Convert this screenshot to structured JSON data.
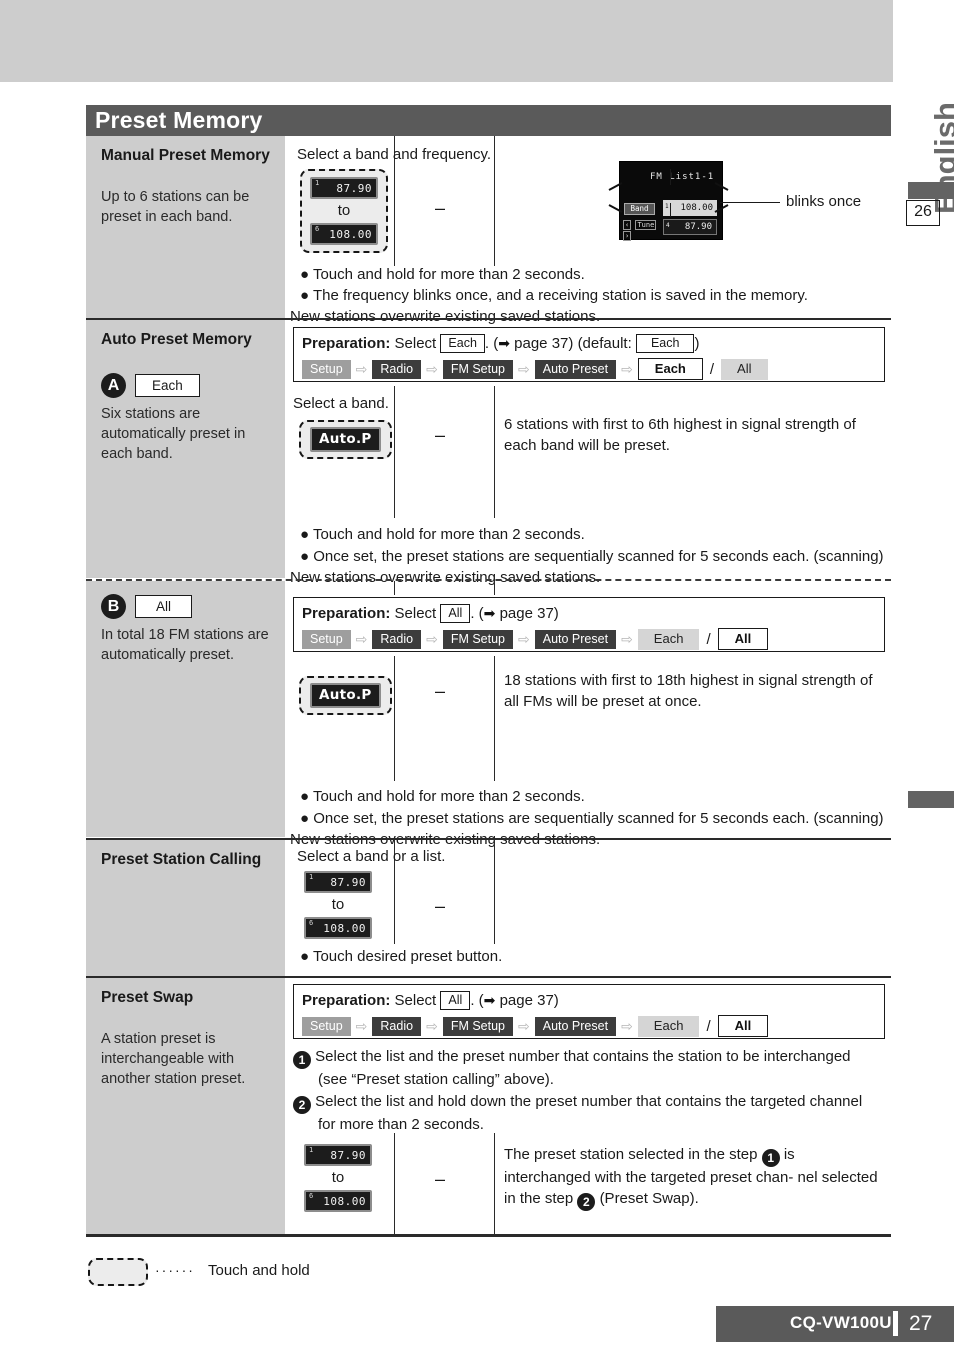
{
  "page": {
    "language_tab": "English",
    "side_page_ref": "26",
    "title": "Preset Memory",
    "model": "CQ-VW100U",
    "page_number": "27"
  },
  "legend": {
    "dots": "······",
    "text": "Touch and hold"
  },
  "lcd": {
    "title": "FM List1-1",
    "band_label": "Band",
    "tune_label": "Tune",
    "tune_left": "‹",
    "tune_right": "›",
    "highlight_num": "1",
    "highlight_value": "108.00",
    "lower_num": "4",
    "lower_value": "87.90",
    "callout": "blinks once"
  },
  "freq_keys": {
    "first_num": "1",
    "first_value": "87.90",
    "last_num": "6",
    "last_value": "108.00",
    "to": "to",
    "dash": "–"
  },
  "auto_p_label": "Auto.P",
  "sections": [
    {
      "id": "manual-preset-memory",
      "heading": "Manual Preset Memory",
      "desc": "Up to 6 stations can be preset in each band.",
      "instruction": "Select a band and frequency.",
      "notes": [
        "● Touch and hold for more than 2 seconds.",
        "● The frequency blinks once, and a receiving station is saved in the memory.",
        "New stations overwrite existing saved stations."
      ]
    },
    {
      "id": "auto-preset-memory-each",
      "heading": "Auto Preset Memory",
      "badge": "A",
      "badge_key": "Each",
      "desc": "Six stations are automatically preset in each band.",
      "preparation": {
        "label": "Preparation:",
        "select_word": "Select",
        "key": "Each",
        "period": ".",
        "page_ref": "page 37",
        "default_prefix": "(default:",
        "default_key": "Each",
        "default_suffix": ")",
        "chain": [
          "Setup",
          "Radio",
          "FM Setup",
          "Auto Preset"
        ],
        "option_selected": "Each",
        "option_other": "All",
        "selected_is_first": true
      },
      "instruction": "Select a band.",
      "result": "6 stations with first to 6th highest in signal strength of each band will be preset.",
      "notes": [
        "● Touch and hold for more than 2 seconds.",
        "● Once set, the preset stations are sequentially scanned for 5 seconds each. (scanning)",
        "New stations overwrite existing saved stations."
      ]
    },
    {
      "id": "auto-preset-memory-all",
      "badge": "B",
      "badge_key": "All",
      "desc": "In total 18 FM stations are automatically preset.",
      "preparation": {
        "label": "Preparation:",
        "select_word": "Select",
        "key": "All",
        "period": ".",
        "page_ref": "page 37",
        "chain": [
          "Setup",
          "Radio",
          "FM Setup",
          "Auto Preset"
        ],
        "option_selected": "All",
        "option_other": "Each",
        "selected_is_first": false
      },
      "result": "18 stations with first to 18th highest in signal strength of all FMs will be preset at once.",
      "notes": [
        "● Touch and hold for more than 2 seconds.",
        "● Once set, the preset stations are sequentially scanned for 5 seconds each. (scanning)",
        "New stations overwrite existing saved stations."
      ]
    },
    {
      "id": "preset-station-calling",
      "heading": "Preset Station Calling",
      "instruction": "Select a band or a list.",
      "notes": [
        "● Touch desired preset button."
      ]
    },
    {
      "id": "preset-swap",
      "heading": "Preset Swap",
      "desc": "A station preset is interchangeable with another station preset.",
      "preparation": {
        "label": "Preparation:",
        "select_word": "Select",
        "key": "All",
        "period": ".",
        "page_ref": "page 37",
        "chain": [
          "Setup",
          "Radio",
          "FM Setup",
          "Auto Preset"
        ],
        "option_selected": "All",
        "option_other": "Each",
        "selected_is_first": false
      },
      "steps": [
        {
          "num": "1",
          "line1": "Select the list and the preset number that contains the station to be interchanged",
          "line2": "(see “Preset station calling” above)."
        },
        {
          "num": "2",
          "line1": "Select the list and hold down the preset number that contains the targeted channel",
          "line2": "for more than 2 seconds."
        }
      ],
      "result_parts": {
        "a": "The preset station selected in the step",
        "b": "is",
        "c": "interchanged with the targeted preset chan-",
        "d": "nel selected in the step",
        "e": "(Preset Swap)."
      }
    }
  ]
}
